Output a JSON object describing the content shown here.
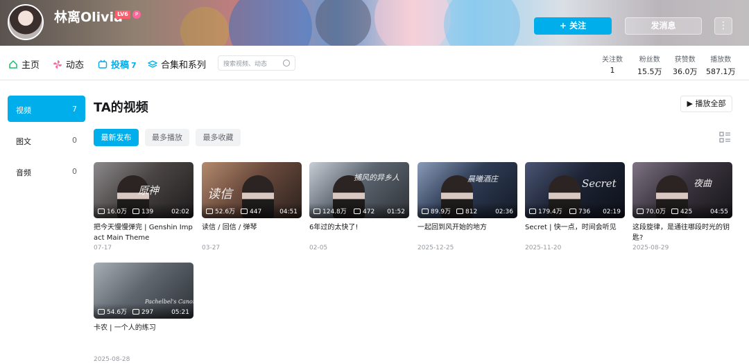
{
  "header": {
    "username": "林离Olivia",
    "level": "LV6",
    "follow_label": "+ 关注",
    "message_label": "发消息",
    "more_label": "⋮"
  },
  "nav": {
    "tabs": [
      {
        "label": "主页",
        "icon": "home-icon"
      },
      {
        "label": "动态",
        "icon": "pinwheel-icon"
      },
      {
        "label": "投稿",
        "count": "7",
        "icon": "tv-icon",
        "active": true
      },
      {
        "label": "合集和系列",
        "icon": "layers-icon"
      }
    ],
    "search_placeholder": "搜索视频、动态",
    "stats": [
      {
        "label": "关注数",
        "value": "1"
      },
      {
        "label": "粉丝数",
        "value": "15.5万"
      },
      {
        "label": "获赞数",
        "value": "36.0万"
      },
      {
        "label": "播放数",
        "value": "587.1万"
      }
    ]
  },
  "sidebar": {
    "items": [
      {
        "label": "视频",
        "count": "7",
        "active": true
      },
      {
        "label": "图文",
        "count": "0"
      },
      {
        "label": "音频",
        "count": "0"
      }
    ]
  },
  "main": {
    "title": "TA的视频",
    "play_all_label": "▶ 播放全部",
    "sort_tabs": [
      {
        "label": "最新发布",
        "active": true
      },
      {
        "label": "最多播放"
      },
      {
        "label": "最多收藏"
      }
    ],
    "videos": [
      {
        "title": "把今天慢慢弹完 | Genshin Impact Main Theme",
        "date": "07-17",
        "plays": "16.0万",
        "danmaku": "139",
        "duration": "02:02",
        "caption": "原神"
      },
      {
        "title": "读信 / 回信 / 弹琴",
        "date": "03-27",
        "plays": "52.6万",
        "danmaku": "447",
        "duration": "04:51",
        "caption": "读信"
      },
      {
        "title": "6年过的太快了!",
        "date": "02-05",
        "plays": "124.8万",
        "danmaku": "472",
        "duration": "01:52",
        "caption": "捕风的异乡人"
      },
      {
        "title": "一起回到风开始的地方",
        "date": "2025-12-25",
        "plays": "89.9万",
        "danmaku": "812",
        "duration": "02:36",
        "caption": "晨曦酒庄"
      },
      {
        "title": "Secret | 快一点，时间会听见",
        "date": "2025-11-20",
        "plays": "179.4万",
        "danmaku": "736",
        "duration": "02:19",
        "caption": "Secret"
      },
      {
        "title": "这段旋律，是通往哪段时光的钥匙?",
        "date": "2025-08-29",
        "plays": "70.0万",
        "danmaku": "425",
        "duration": "04:55",
        "caption": "夜曲"
      },
      {
        "title": "卡农 | 一个人的练习",
        "date": "2025-08-28",
        "plays": "54.6万",
        "danmaku": "297",
        "duration": "05:21",
        "caption": "Pachelbel's Canon"
      }
    ]
  },
  "colors": {
    "accent": "#00aeec",
    "text": "#18191c",
    "muted": "#9499a0"
  }
}
